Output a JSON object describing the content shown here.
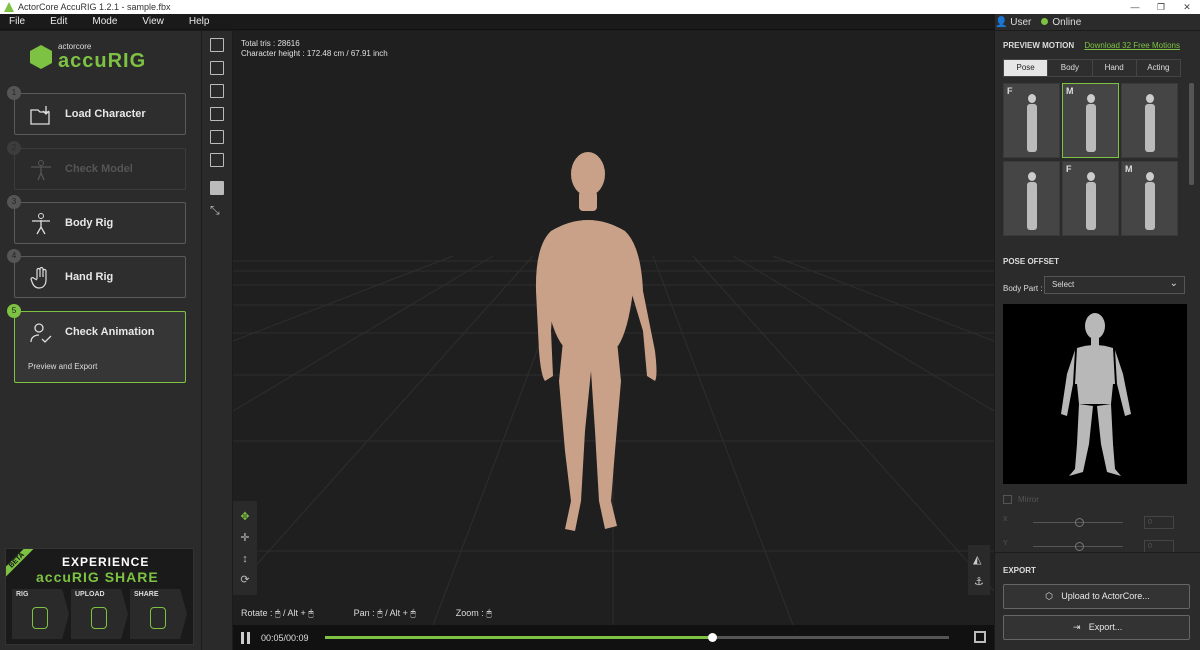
{
  "window": {
    "title": "ActorCore AccuRIG 1.2.1 - sample.fbx"
  },
  "menu": {
    "items": [
      "File",
      "Edit",
      "Mode",
      "View",
      "Help"
    ],
    "user": "User",
    "status": "Online"
  },
  "brand": {
    "top": "actorcore",
    "name": "accuRIG"
  },
  "steps": [
    {
      "num": "1",
      "label": "Load Character",
      "icon": "folder-import-icon"
    },
    {
      "num": "2",
      "label": "Check Model",
      "icon": "t-pose-icon"
    },
    {
      "num": "3",
      "label": "Body Rig",
      "icon": "body-icon"
    },
    {
      "num": "4",
      "label": "Hand Rig",
      "icon": "hand-icon"
    },
    {
      "num": "5",
      "label": "Check Animation",
      "sub": "Preview and Export",
      "icon": "user-check-icon"
    }
  ],
  "banner": {
    "beta": "BETA",
    "line1": "EXPERIENCE",
    "line2": "accuRIG SHARE",
    "boxes": [
      "RIG",
      "UPLOAD",
      "SHARE"
    ]
  },
  "viewport": {
    "total_tris": "Total tris : 28616",
    "height": "Character height : 172.48 cm / 67.91 inch",
    "hints": {
      "rotate": "Rotate :",
      "alt": "/ Alt +",
      "pan": "Pan :",
      "zoom": "Zoom :"
    }
  },
  "timeline": {
    "time": "00:05/00:09",
    "progress": 0.62
  },
  "preview_motion": {
    "title": "PREVIEW MOTION",
    "link": "Download 32 Free Motions",
    "tabs": [
      "Pose",
      "Body",
      "Hand",
      "Acting"
    ],
    "selected_tab": "Pose",
    "thumbs": [
      "F",
      "M",
      "",
      "",
      "F",
      "M"
    ]
  },
  "pose_offset": {
    "title": "POSE OFFSET",
    "body_part_label": "Body Part :",
    "body_part_value": "Select",
    "mirror": "Mirror",
    "x_label": "X",
    "y_label": "Y",
    "x_value": "0",
    "y_value": "0"
  },
  "export": {
    "title": "EXPORT",
    "upload": "Upload to ActorCore...",
    "export": "Export..."
  },
  "colors": {
    "accent": "#7dc242",
    "panel": "#2b2b2b",
    "viewport": "#1f1f1f"
  }
}
